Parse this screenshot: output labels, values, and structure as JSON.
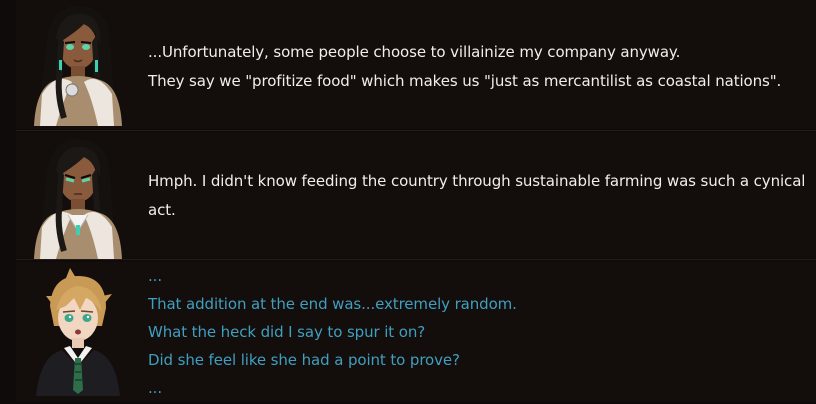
{
  "dialogue": [
    {
      "speaker_icon": "dark-haired-woman-portrait",
      "text_color": "#f2eeea",
      "lines": [
        "...Unfortunately, some people choose to villainize my company anyway.",
        "They say we \"profitize food\" which makes us \"just as mercantilist as coastal nations\"."
      ]
    },
    {
      "speaker_icon": "dark-haired-woman-portrait-frown",
      "text_color": "#f2eeea",
      "lines": [
        "Hmph. I didn't know feeding the country through sustainable farming was such a cynical act."
      ]
    },
    {
      "speaker_icon": "blond-boy-portrait",
      "text_color": "#3f9fc0",
      "lines": [
        "...",
        "That addition at the end was...extremely random.",
        "What the heck did I say to spur it on?",
        "Did she feel like she had a point to prove?",
        "..."
      ]
    }
  ]
}
